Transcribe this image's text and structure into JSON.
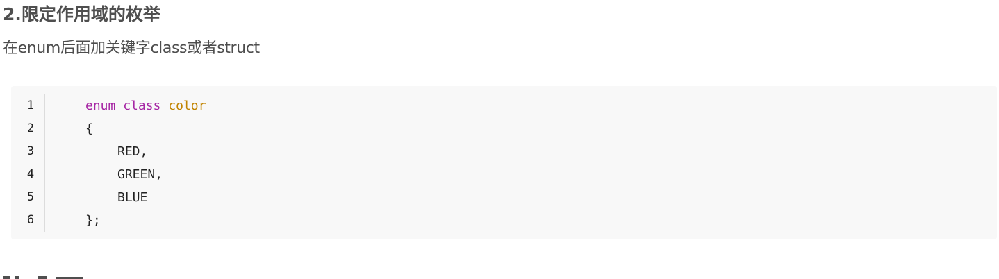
{
  "section": {
    "title": "2.限定作用域的枚举",
    "description": "在enum后面加关键字class或者struct"
  },
  "code_block": {
    "language": "cpp",
    "line_numbers": [
      "1",
      "2",
      "3",
      "4",
      "5",
      "6"
    ],
    "lines": {
      "l1_keyword_enum": "enum",
      "l1_keyword_class": "class",
      "l1_type_name": "color",
      "l2": "{",
      "l3": "RED,",
      "l4": "GREEN,",
      "l5": "BLUE",
      "l6": "};"
    },
    "colors": {
      "background": "#f8f8f8",
      "keyword": "#a626a4",
      "type_name": "#c18401",
      "text": "#222222"
    }
  }
}
